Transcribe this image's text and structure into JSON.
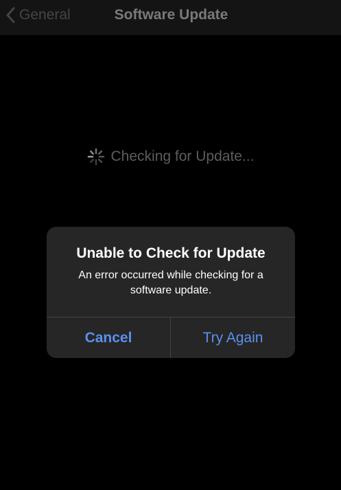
{
  "nav": {
    "back_label": "General",
    "title": "Software Update"
  },
  "status": {
    "checking_label": "Checking for Update..."
  },
  "alert": {
    "title": "Unable to Check for Update",
    "message": "An error occurred while checking for a software update.",
    "cancel_label": "Cancel",
    "try_again_label": "Try Again"
  },
  "icons": {
    "back": "chevron-left-icon",
    "spinner": "activity-spinner-icon"
  },
  "colors": {
    "background": "#000000",
    "nav_background": "#141414",
    "alert_background": "#262626",
    "button_blue": "#5b8ff0",
    "dimmed_text": "#454545"
  }
}
